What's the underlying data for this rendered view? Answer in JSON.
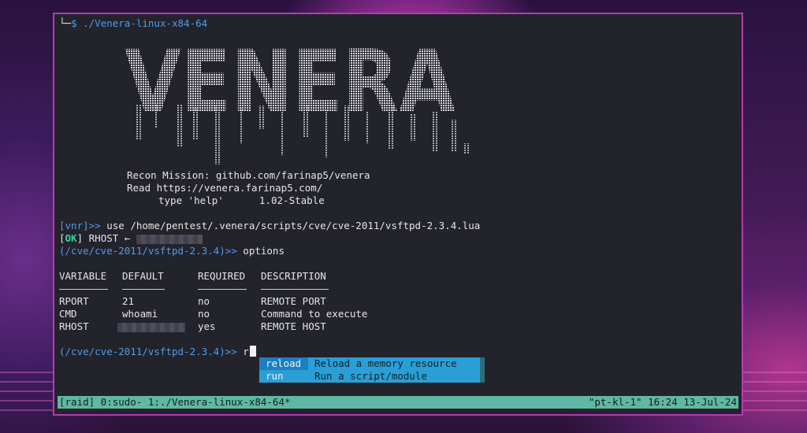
{
  "terminal": {
    "command_line": {
      "corner": "└─",
      "dollar": "$",
      "command": "./Venera-linux-x84-64"
    },
    "logo_text": "VENERA",
    "banner": {
      "line1": "Recon Mission: github.com/farinap5/venera",
      "line2": "Read https://venera.farinap5.com/",
      "line3": "type 'help'      1.02-Stable"
    },
    "session": {
      "vnr_prompt": "[vnr]>>",
      "use_command": " use /home/pentest/.venera/scripts/cve/cve-2011/vsftpd-2.3.4.lua",
      "ok_open": "[",
      "ok_label": "OK",
      "ok_close": "]",
      "ok_text": " RHOST ←",
      "module_prompt": "(/cve/cve-2011/vsftpd-2.3.4)>>",
      "options_cmd": " options",
      "typed": " r"
    },
    "options_table": {
      "headers": [
        "VARIABLE",
        "DEFAULT",
        "REQUIRED",
        "DESCRIPTION"
      ],
      "rows": [
        [
          "RPORT",
          "21",
          "no",
          "REMOTE PORT"
        ],
        [
          "CMD",
          "whoami",
          "no",
          "Command to execute"
        ],
        [
          "RHOST",
          "",
          "yes",
          "REMOTE HOST"
        ]
      ]
    },
    "autocomplete": [
      {
        "cmd": "reload",
        "desc": "Reload a memory resource"
      },
      {
        "cmd": "run",
        "desc": "Run a script/module"
      }
    ],
    "statusbar": {
      "left": "[raid] 0:sudo- 1:./Venera-linux-x84-64*",
      "right": "\"pt-kl-1\" 16:24 13-Jul-24"
    },
    "colors": {
      "border": "#b53bb0",
      "prompt_blue": "#4f9de8",
      "ok_green": "#35d59f",
      "status_bg": "#5fb8a3",
      "popup_bg": "#2a9fd6"
    }
  }
}
